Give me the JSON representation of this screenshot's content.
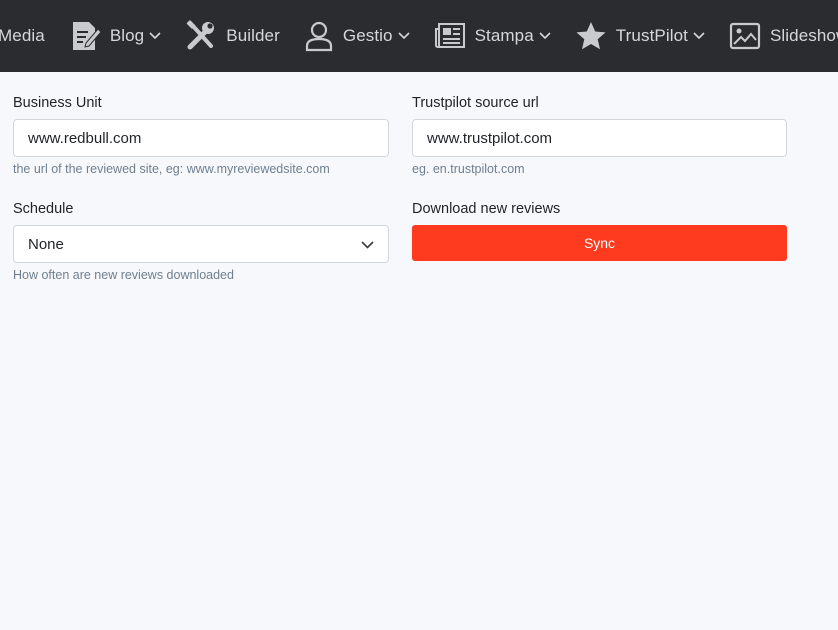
{
  "nav": {
    "items": [
      {
        "label": "Media",
        "icon": "media-icon",
        "has_dropdown": false
      },
      {
        "label": "Blog",
        "icon": "blog-document-icon",
        "has_dropdown": true
      },
      {
        "label": "Builder",
        "icon": "tools-icon",
        "has_dropdown": false
      },
      {
        "label": "Gestio",
        "icon": "user-icon",
        "has_dropdown": true
      },
      {
        "label": "Stampa",
        "icon": "newspaper-icon",
        "has_dropdown": true
      },
      {
        "label": "TrustPilot",
        "icon": "star-icon",
        "has_dropdown": true
      },
      {
        "label": "Slideshow",
        "icon": "image-icon",
        "has_dropdown": false
      }
    ]
  },
  "form": {
    "business_unit": {
      "label": "Business Unit",
      "value": "www.redbull.com",
      "help": "the url of the reviewed site, eg: www.myreviewedsite.com"
    },
    "source_url": {
      "label": "Trustpilot source url",
      "value": "www.trustpilot.com",
      "help": "eg. en.trustpilot.com"
    },
    "schedule": {
      "label": "Schedule",
      "value": "None",
      "help": "How often are new reviews downloaded"
    },
    "download": {
      "label": "Download new reviews",
      "button_label": "Sync"
    }
  },
  "colors": {
    "topbar": "#2b2c2f",
    "accent": "#ff3b1f",
    "background": "#f7f8fb"
  }
}
